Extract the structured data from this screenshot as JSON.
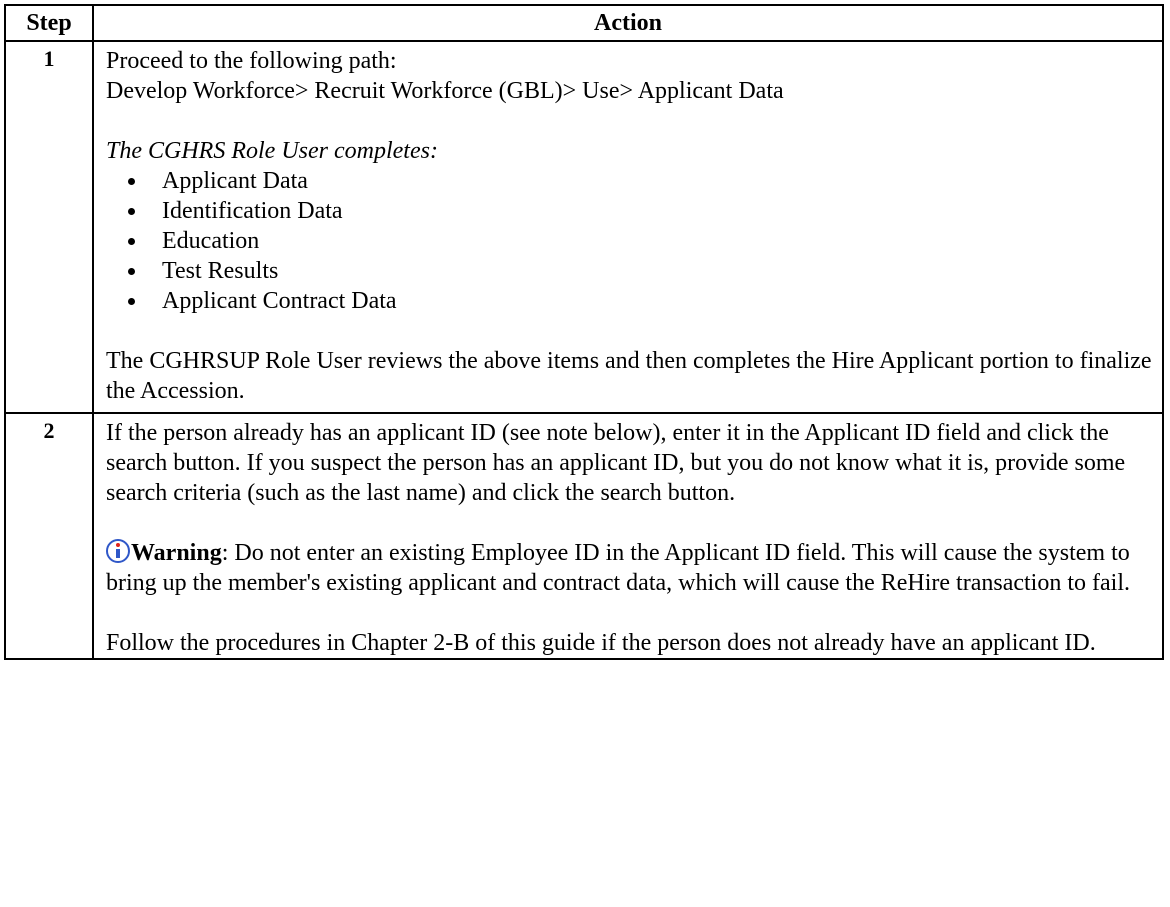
{
  "table": {
    "headers": {
      "step": "Step",
      "action": "Action"
    },
    "step1": {
      "number": "1",
      "line1": "Proceed to the following path:",
      "path": "Develop Workforce> Recruit Workforce (GBL)> Use> Applicant Data",
      "intro": "The CGHRS Role User completes:",
      "items": [
        "Applicant Data",
        "Identification Data",
        "Education",
        "Test Results",
        "Applicant Contract Data"
      ],
      "review": "The CGHRSUP Role User reviews the above items and then completes the Hire Applicant portion to finalize the Accession."
    },
    "step2": {
      "number": "2",
      "instructions": "If the person already has an applicant ID (see note below), enter it in the Applicant ID field and click the search button. If you suspect the person has an applicant ID, but you do not know what it is, provide some search criteria (such as the last name) and click the search button.",
      "warning_label": "Warning",
      "warning_text": ": Do not enter an existing Employee ID in the Applicant ID field. This will cause the system to bring up the member's existing applicant and contract data, which will cause the ReHire transaction to fail.",
      "followup": "Follow the procedures in Chapter 2-B of this guide if the person does not already have an applicant ID."
    }
  },
  "icons": {
    "warning_icon": "info-warning-icon",
    "accent_blue": "#2f57c8",
    "accent_red": "#e0231b"
  }
}
